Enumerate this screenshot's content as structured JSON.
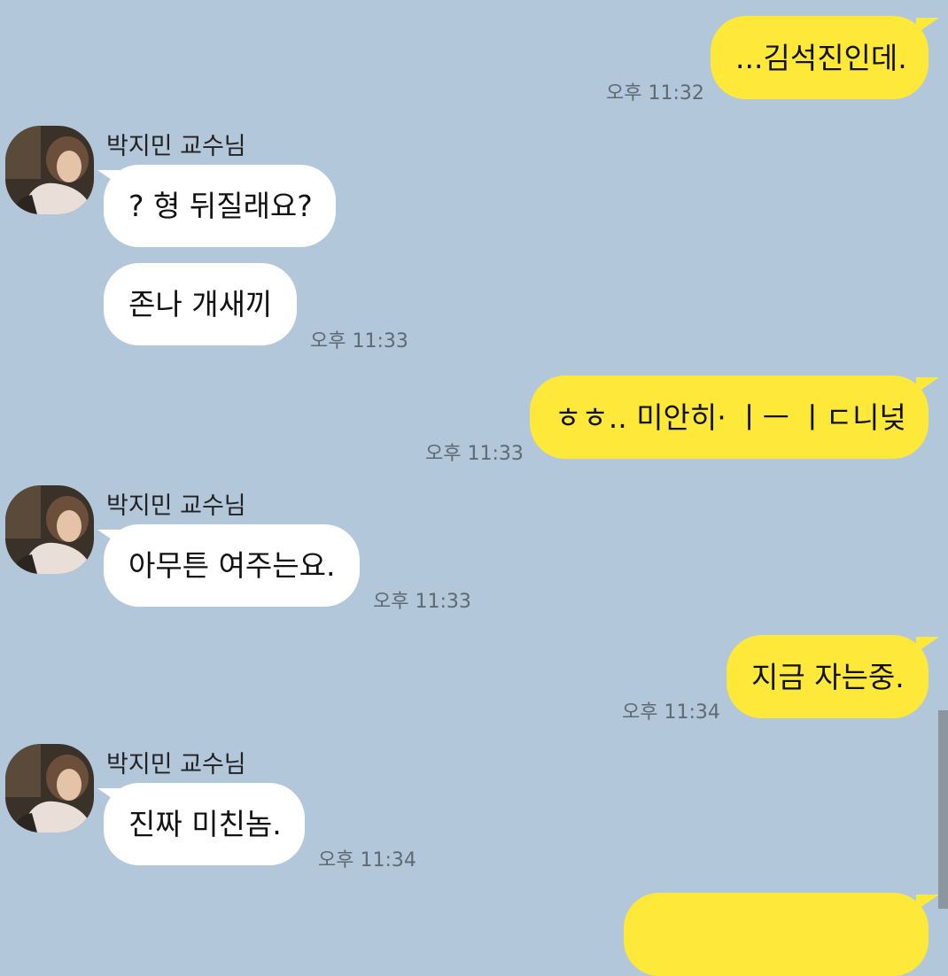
{
  "colors": {
    "background": "#b2c7da",
    "my_bubble": "#fee93a",
    "their_bubble": "#ffffff",
    "time": "#5f6a73"
  },
  "contact": {
    "name": "박지민 교수님",
    "avatar_icon": "profile-photo"
  },
  "messages": [
    {
      "sender": "me",
      "text": "...김석진인데.",
      "time": "오후 11:32"
    },
    {
      "sender": "them",
      "name": "박지민 교수님",
      "text": "? 형 뒤질래요?"
    },
    {
      "sender": "them",
      "text": "존나 개새끼",
      "time": "오후 11:33"
    },
    {
      "sender": "me",
      "text": "ㅎㅎ.. 미안히· ㅣㅡ ㅣㄷ니넞",
      "time": "오후 11:33"
    },
    {
      "sender": "them",
      "name": "박지민 교수님",
      "text": "아무튼 여주는요.",
      "time": "오후 11:33"
    },
    {
      "sender": "me",
      "text": "지금 자는중.",
      "time": "오후 11:34"
    },
    {
      "sender": "them",
      "name": "박지민 교수님",
      "text": "진짜 미친놈.",
      "time": "오후 11:34"
    }
  ]
}
